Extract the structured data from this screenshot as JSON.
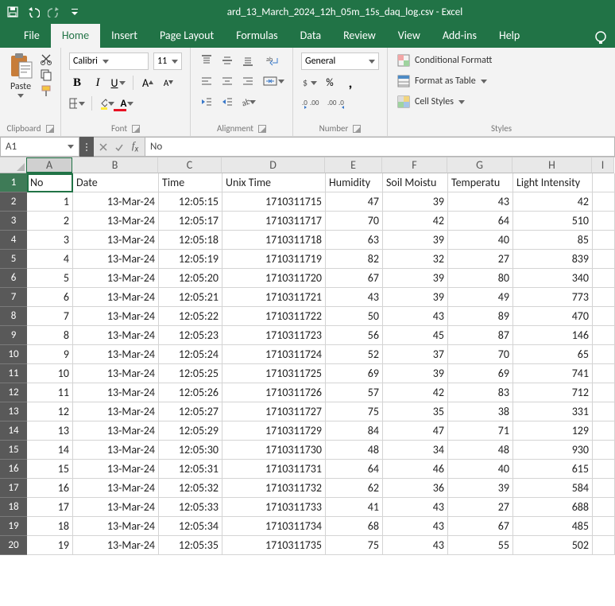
{
  "titlebar": {
    "title": "ard_13_March_2024_12h_05m_15s_daq_log.csv  -  Excel"
  },
  "tabs": [
    "File",
    "Home",
    "Insert",
    "Page Layout",
    "Formulas",
    "Data",
    "Review",
    "View",
    "Add-ins",
    "Help"
  ],
  "activeTab": 1,
  "ribbon": {
    "clipboard": {
      "paste": "Paste",
      "label": "Clipboard"
    },
    "font": {
      "name": "Calibri",
      "size": "11",
      "label": "Font"
    },
    "alignment": {
      "label": "Alignment"
    },
    "number": {
      "format": "General",
      "label": "Number"
    },
    "styles": {
      "cond": "Conditional Formatt",
      "table": "Format as Table",
      "cell": "Cell Styles",
      "label": "Styles"
    }
  },
  "fbar": {
    "cellref": "A1",
    "value": "No"
  },
  "columns": [
    "A",
    "B",
    "C",
    "D",
    "E",
    "F",
    "G",
    "H",
    "I"
  ],
  "headers": [
    "No",
    "Date",
    "Time",
    "Unix Time",
    "Humidity",
    "Soil Moistu",
    "Temperatu",
    "Light Intensity",
    ""
  ],
  "rows": [
    {
      "n": 1,
      "no": "1",
      "date": "13-Mar-24",
      "time": "12:05:15",
      "unix": "1710311715",
      "h": "47",
      "s": "39",
      "t": "43",
      "l": "42"
    },
    {
      "n": 2,
      "no": "2",
      "date": "13-Mar-24",
      "time": "12:05:17",
      "unix": "1710311717",
      "h": "70",
      "s": "42",
      "t": "64",
      "l": "510"
    },
    {
      "n": 3,
      "no": "3",
      "date": "13-Mar-24",
      "time": "12:05:18",
      "unix": "1710311718",
      "h": "63",
      "s": "39",
      "t": "40",
      "l": "85"
    },
    {
      "n": 4,
      "no": "4",
      "date": "13-Mar-24",
      "time": "12:05:19",
      "unix": "1710311719",
      "h": "82",
      "s": "32",
      "t": "27",
      "l": "839"
    },
    {
      "n": 5,
      "no": "5",
      "date": "13-Mar-24",
      "time": "12:05:20",
      "unix": "1710311720",
      "h": "67",
      "s": "39",
      "t": "80",
      "l": "340"
    },
    {
      "n": 6,
      "no": "6",
      "date": "13-Mar-24",
      "time": "12:05:21",
      "unix": "1710311721",
      "h": "43",
      "s": "39",
      "t": "49",
      "l": "773"
    },
    {
      "n": 7,
      "no": "7",
      "date": "13-Mar-24",
      "time": "12:05:22",
      "unix": "1710311722",
      "h": "50",
      "s": "43",
      "t": "89",
      "l": "470"
    },
    {
      "n": 8,
      "no": "8",
      "date": "13-Mar-24",
      "time": "12:05:23",
      "unix": "1710311723",
      "h": "56",
      "s": "45",
      "t": "87",
      "l": "146"
    },
    {
      "n": 9,
      "no": "9",
      "date": "13-Mar-24",
      "time": "12:05:24",
      "unix": "1710311724",
      "h": "52",
      "s": "37",
      "t": "70",
      "l": "65"
    },
    {
      "n": 10,
      "no": "10",
      "date": "13-Mar-24",
      "time": "12:05:25",
      "unix": "1710311725",
      "h": "69",
      "s": "39",
      "t": "69",
      "l": "741"
    },
    {
      "n": 11,
      "no": "11",
      "date": "13-Mar-24",
      "time": "12:05:26",
      "unix": "1710311726",
      "h": "57",
      "s": "42",
      "t": "83",
      "l": "712"
    },
    {
      "n": 12,
      "no": "12",
      "date": "13-Mar-24",
      "time": "12:05:27",
      "unix": "1710311727",
      "h": "75",
      "s": "35",
      "t": "38",
      "l": "331"
    },
    {
      "n": 13,
      "no": "13",
      "date": "13-Mar-24",
      "time": "12:05:29",
      "unix": "1710311729",
      "h": "84",
      "s": "47",
      "t": "71",
      "l": "129"
    },
    {
      "n": 14,
      "no": "14",
      "date": "13-Mar-24",
      "time": "12:05:30",
      "unix": "1710311730",
      "h": "48",
      "s": "34",
      "t": "48",
      "l": "930"
    },
    {
      "n": 15,
      "no": "15",
      "date": "13-Mar-24",
      "time": "12:05:31",
      "unix": "1710311731",
      "h": "64",
      "s": "46",
      "t": "40",
      "l": "615"
    },
    {
      "n": 16,
      "no": "16",
      "date": "13-Mar-24",
      "time": "12:05:32",
      "unix": "1710311732",
      "h": "62",
      "s": "36",
      "t": "39",
      "l": "584"
    },
    {
      "n": 17,
      "no": "17",
      "date": "13-Mar-24",
      "time": "12:05:33",
      "unix": "1710311733",
      "h": "41",
      "s": "43",
      "t": "27",
      "l": "688"
    },
    {
      "n": 18,
      "no": "18",
      "date": "13-Mar-24",
      "time": "12:05:34",
      "unix": "1710311734",
      "h": "68",
      "s": "43",
      "t": "67",
      "l": "485"
    },
    {
      "n": 19,
      "no": "19",
      "date": "13-Mar-24",
      "time": "12:05:35",
      "unix": "1710311735",
      "h": "75",
      "s": "43",
      "t": "55",
      "l": "502"
    }
  ]
}
